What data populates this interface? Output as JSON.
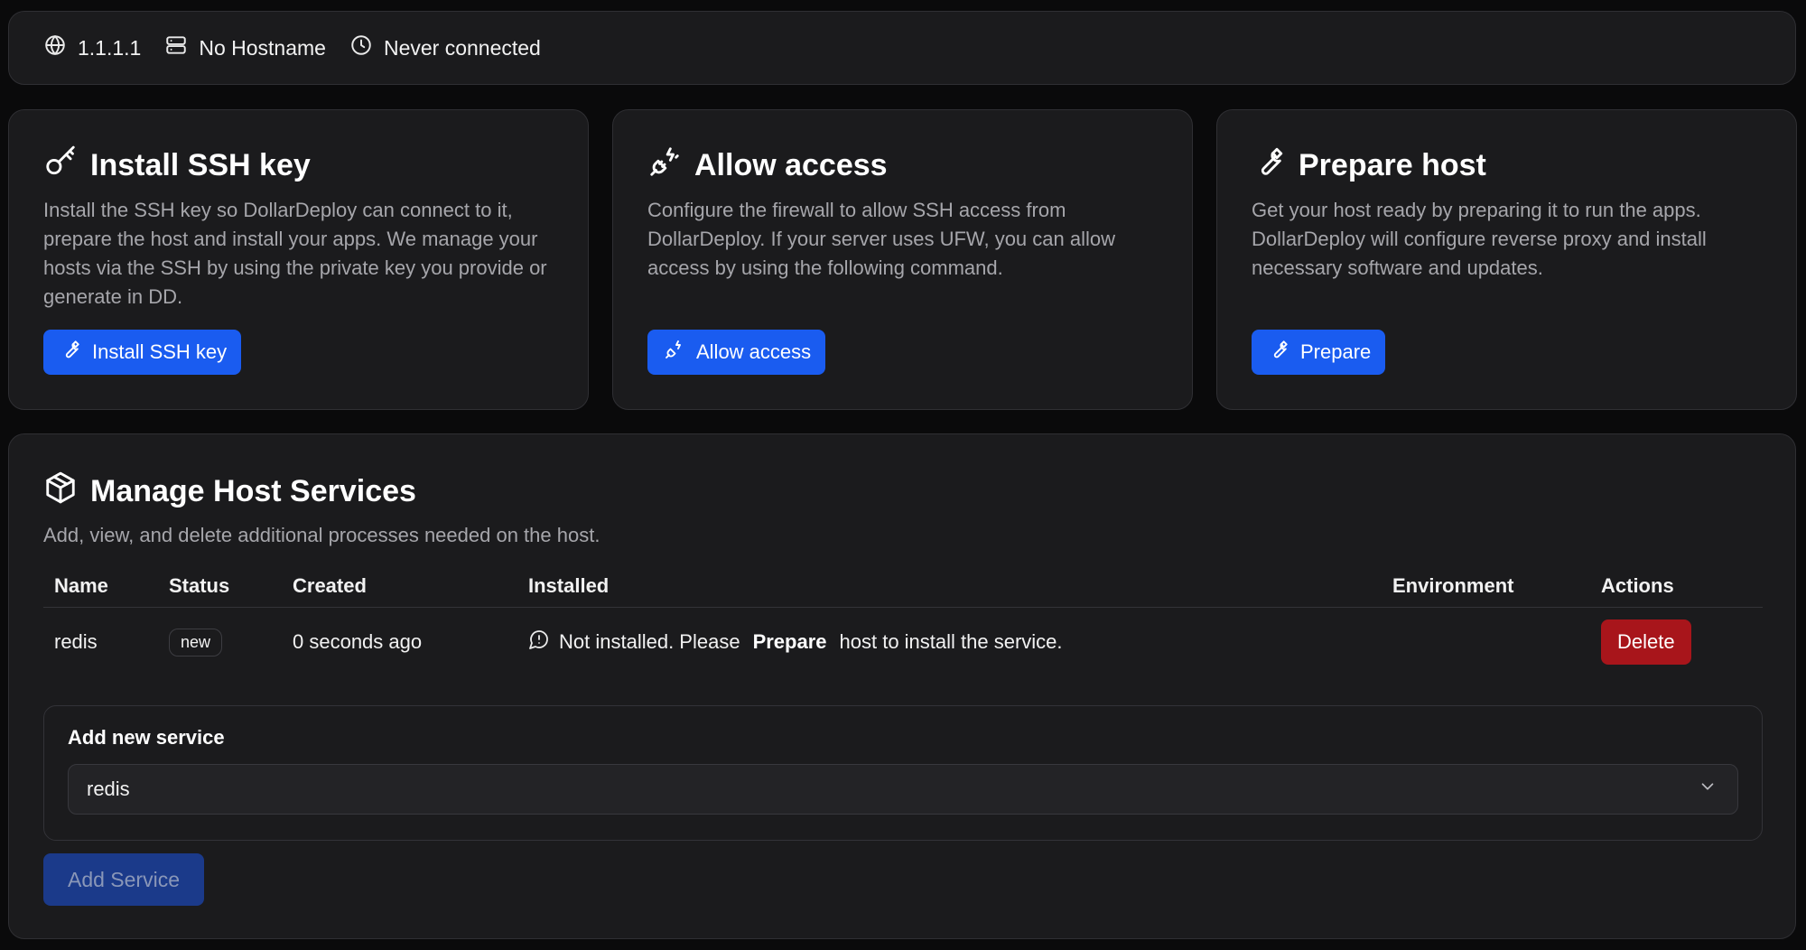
{
  "infobar": {
    "ip": "1.1.1.1",
    "hostname": "No Hostname",
    "connection": "Never connected"
  },
  "cards": [
    {
      "title": "Install SSH key",
      "description": "Install the SSH key so DollarDeploy can connect to it, prepare the host and install your apps. We manage your hosts via the SSH by using the private key you provide or generate in DD.",
      "button": "Install SSH key"
    },
    {
      "title": "Allow access",
      "description": "Configure the firewall to allow SSH access from DollarDeploy. If your server uses UFW, you can allow access by using the following command.",
      "button": "Allow access"
    },
    {
      "title": "Prepare host",
      "description": "Get your host ready by preparing it to run the apps. DollarDeploy will configure reverse proxy and install necessary software and updates.",
      "button": "Prepare"
    }
  ],
  "services": {
    "title": "Manage Host Services",
    "description": "Add, view, and delete additional processes needed on the host.",
    "columns": [
      "Name",
      "Status",
      "Created",
      "Installed",
      "Environment",
      "Actions"
    ],
    "rows": [
      {
        "name": "redis",
        "status": "new",
        "created": "0 seconds ago",
        "installed_pre": "Not installed. Please",
        "installed_bold": "Prepare",
        "installed_post": "host to install the service.",
        "environment": "",
        "action": "Delete"
      }
    ],
    "add_label": "Add new service",
    "select_value": "redis",
    "add_button": "Add Service"
  },
  "colors": {
    "primary": "#1a5cf0",
    "danger": "#a8151b",
    "card_bg": "#1b1b1d",
    "page_bg": "#0a0a0b"
  }
}
